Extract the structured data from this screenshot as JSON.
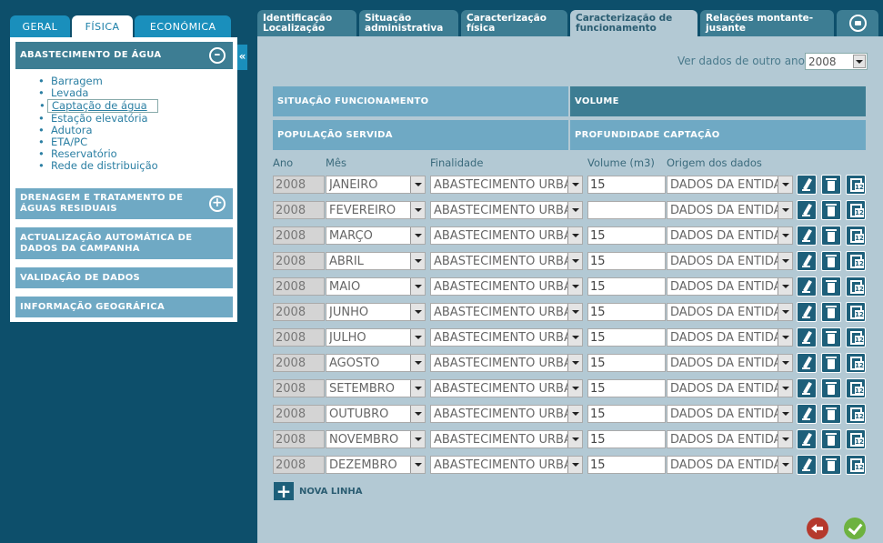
{
  "sidebar": {
    "tabs": [
      {
        "label": "GERAL",
        "active": false
      },
      {
        "label": "FÍSICA",
        "active": true
      },
      {
        "label": "ECONÓMICA",
        "active": false
      }
    ],
    "sections": {
      "abastecimento": {
        "label": "ABASTECIMENTO DE ÁGUA",
        "icon": "minus-circle-icon"
      },
      "drenagem": {
        "label": "DRENAGEM E TRATAMENTO DE ÁGUAS RESIDUAIS",
        "icon": "plus-circle-icon"
      },
      "actualizacao": {
        "label": "ACTUALIZAÇÃO AUTOMÁTICA DE DADOS DA CAMPANHA"
      },
      "validacao": {
        "label": "VALIDAÇÃO DE DADOS"
      },
      "informacao": {
        "label": "INFORMAÇÃO GEOGRÁFICA"
      }
    },
    "items": [
      "Barragem",
      "Levada",
      "Captação de água",
      "Estação elevatória",
      "Adutora",
      "ETA/PC",
      "Reservatório",
      "Rede de distribuição"
    ],
    "selected_item": "Captação de água",
    "collapse_label": "«"
  },
  "top_tabs": [
    {
      "label": "Identificação Localização"
    },
    {
      "label": "Situação administrativa"
    },
    {
      "label": "Caracterização física"
    },
    {
      "label": "Caracterização de funcionamento",
      "active": true
    },
    {
      "label": "Relações montante-jusante"
    }
  ],
  "year_filter": {
    "label": "Ver dados de outro ano",
    "value": "2008"
  },
  "sections": {
    "situacao": "SITUAÇÃO FUNCIONAMENTO",
    "volume": "VOLUME",
    "populacao": "POPULAÇÃO SERVIDA",
    "profundidade": "PROFUNDIDADE CAPTAÇÃO"
  },
  "columns": {
    "ano": "Ano",
    "mes": "Mês",
    "finalidade": "Finalidade",
    "volume": "Volume (m3)",
    "origem": "Origem dos dados"
  },
  "rows": [
    {
      "ano": "2008",
      "mes": "JANEIRO",
      "finalidade": "ABASTECIMENTO URBANO",
      "volume": "15",
      "origem": "DADOS DA ENTIDADE"
    },
    {
      "ano": "2008",
      "mes": "FEVEREIRO",
      "finalidade": "ABASTECIMENTO URBANO",
      "volume": "",
      "origem": "DADOS DA ENTIDADE"
    },
    {
      "ano": "2008",
      "mes": "MARÇO",
      "finalidade": "ABASTECIMENTO URBANO",
      "volume": "15",
      "origem": "DADOS DA ENTIDADE"
    },
    {
      "ano": "2008",
      "mes": "ABRIL",
      "finalidade": "ABASTECIMENTO URBANO",
      "volume": "15",
      "origem": "DADOS DA ENTIDADE"
    },
    {
      "ano": "2008",
      "mes": "MAIO",
      "finalidade": "ABASTECIMENTO URBANO",
      "volume": "15",
      "origem": "DADOS DA ENTIDADE"
    },
    {
      "ano": "2008",
      "mes": "JUNHO",
      "finalidade": "ABASTECIMENTO URBANO",
      "volume": "15",
      "origem": "DADOS DA ENTIDADE"
    },
    {
      "ano": "2008",
      "mes": "JULHO",
      "finalidade": "ABASTECIMENTO URBANO",
      "volume": "15",
      "origem": "DADOS DA ENTIDADE"
    },
    {
      "ano": "2008",
      "mes": "AGOSTO",
      "finalidade": "ABASTECIMENTO URBANO",
      "volume": "15",
      "origem": "DADOS DA ENTIDADE"
    },
    {
      "ano": "2008",
      "mes": "SETEMBRO",
      "finalidade": "ABASTECIMENTO URBANO",
      "volume": "15",
      "origem": "DADOS DA ENTIDADE"
    },
    {
      "ano": "2008",
      "mes": "OUTUBRO",
      "finalidade": "ABASTECIMENTO URBANO",
      "volume": "15",
      "origem": "DADOS DA ENTIDADE"
    },
    {
      "ano": "2008",
      "mes": "NOVEMBRO",
      "finalidade": "ABASTECIMENTO URBANO",
      "volume": "15",
      "origem": "DADOS DA ENTIDADE"
    },
    {
      "ano": "2008",
      "mes": "DEZEMBRO",
      "finalidade": "ABASTECIMENTO URBANO",
      "volume": "15",
      "origem": "DADOS DA ENTIDADE"
    }
  ],
  "row_actions": [
    "pencil-icon",
    "trash-icon",
    "copy-icon"
  ],
  "add_row_label": "NOVA LINHA",
  "footer": {
    "back_icon": "back-arrow-icon",
    "confirm_icon": "check-icon"
  },
  "colors": {
    "dark_blue": "#0d4f6b",
    "tab_blue": "#3d7d93",
    "light_blue": "#6fa9c4",
    "panel_bg": "#b3c9d4",
    "accent": "#1a8fbc",
    "back": "#b5392d",
    "ok": "#6db23f"
  }
}
